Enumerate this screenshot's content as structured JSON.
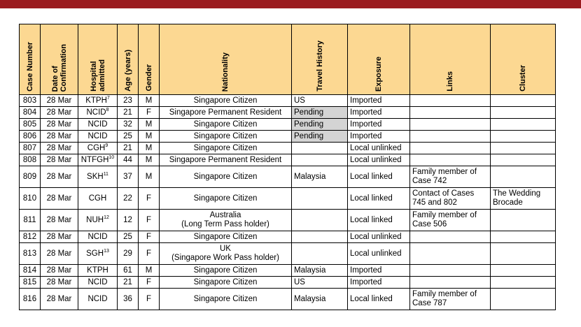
{
  "headers": {
    "case_number": "Case Number",
    "date_of_confirmation": "Date of\nConfirmation",
    "hospital_admitted": "Hospital\nadmitted",
    "age": "Age (years)",
    "gender": "Gender",
    "nationality": "Nationality",
    "travel_history": "Travel History",
    "exposure": "Exposure",
    "links": "Links",
    "cluster": "Cluster"
  },
  "rows": [
    {
      "case": "803",
      "date": "28 Mar",
      "hospital": "KTPH",
      "hospital_sup": "7",
      "age": "23",
      "gender": "M",
      "nationality": "Singapore Citizen",
      "travel": "US",
      "exposure": "Imported",
      "links": "",
      "cluster": ""
    },
    {
      "case": "804",
      "date": "28 Mar",
      "hospital": "NCID",
      "hospital_sup": "8",
      "age": "21",
      "gender": "F",
      "nationality": "Singapore Permanent Resident",
      "travel": "Pending",
      "exposure": "Imported",
      "links": "",
      "cluster": ""
    },
    {
      "case": "805",
      "date": "28 Mar",
      "hospital": "NCID",
      "hospital_sup": "",
      "age": "32",
      "gender": "M",
      "nationality": "Singapore Citizen",
      "travel": "Pending",
      "exposure": "Imported",
      "links": "",
      "cluster": ""
    },
    {
      "case": "806",
      "date": "28 Mar",
      "hospital": "NCID",
      "hospital_sup": "",
      "age": "25",
      "gender": "M",
      "nationality": "Singapore Citizen",
      "travel": "Pending",
      "exposure": "Imported",
      "links": "",
      "cluster": ""
    },
    {
      "case": "807",
      "date": "28 Mar",
      "hospital": "CGH",
      "hospital_sup": "9",
      "age": "21",
      "gender": "M",
      "nationality": "Singapore Citizen",
      "travel": "",
      "exposure": "Local unlinked",
      "links": "",
      "cluster": ""
    },
    {
      "case": "808",
      "date": "28 Mar",
      "hospital": "NTFGH",
      "hospital_sup": "10",
      "age": "44",
      "gender": "M",
      "nationality": "Singapore Permanent Resident",
      "travel": "",
      "exposure": "Local unlinked",
      "links": "",
      "cluster": ""
    },
    {
      "case": "809",
      "date": "28 Mar",
      "hospital": "SKH",
      "hospital_sup": "11",
      "age": "37",
      "gender": "M",
      "nationality": "Singapore Citizen",
      "travel": "Malaysia",
      "exposure": "Local linked",
      "links": "Family member of\nCase 742",
      "cluster": ""
    },
    {
      "case": "810",
      "date": "28 Mar",
      "hospital": "CGH",
      "hospital_sup": "",
      "age": "22",
      "gender": "F",
      "nationality": "Singapore Citizen",
      "travel": "",
      "exposure": "Local linked",
      "links": "Contact of Cases\n745 and 802",
      "cluster": "The Wedding\nBrocade"
    },
    {
      "case": "811",
      "date": "28 Mar",
      "hospital": "NUH",
      "hospital_sup": "12",
      "age": "12",
      "gender": "F",
      "nationality": "Australia\n(Long Term Pass holder)",
      "travel": "",
      "exposure": "Local linked",
      "links": "Family member of\nCase 506",
      "cluster": ""
    },
    {
      "case": "812",
      "date": "28 Mar",
      "hospital": "NCID",
      "hospital_sup": "",
      "age": "25",
      "gender": "F",
      "nationality": "Singapore Citizen",
      "travel": "",
      "exposure": "Local unlinked",
      "links": "",
      "cluster": ""
    },
    {
      "case": "813",
      "date": "28 Mar",
      "hospital": "SGH",
      "hospital_sup": "13",
      "age": "29",
      "gender": "F",
      "nationality": "UK\n(Singapore Work Pass holder)",
      "travel": "",
      "exposure": "Local unlinked",
      "links": "",
      "cluster": ""
    },
    {
      "case": "814",
      "date": "28 Mar",
      "hospital": "KTPH",
      "hospital_sup": "",
      "age": "61",
      "gender": "M",
      "nationality": "Singapore Citizen",
      "travel": "Malaysia",
      "exposure": "Imported",
      "links": "",
      "cluster": ""
    },
    {
      "case": "815",
      "date": "28 Mar",
      "hospital": "NCID",
      "hospital_sup": "",
      "age": "21",
      "gender": "F",
      "nationality": "Singapore Citizen",
      "travel": "US",
      "exposure": "Imported",
      "links": "",
      "cluster": ""
    },
    {
      "case": "816",
      "date": "28 Mar",
      "hospital": "NCID",
      "hospital_sup": "",
      "age": "36",
      "gender": "F",
      "nationality": "Singapore Citizen",
      "travel": "Malaysia",
      "exposure": "Local linked",
      "links": "Family member of\nCase 787",
      "cluster": ""
    }
  ],
  "colors": {
    "header_bg": "#fcd892",
    "top_bar": "#9b1b1f",
    "pending_bg": "#d4d4d4"
  }
}
